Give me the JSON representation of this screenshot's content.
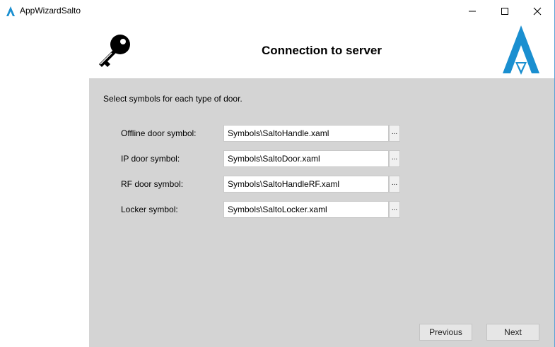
{
  "window": {
    "app_title": "AppWizardSalto",
    "brand_color": "#1a8fd0"
  },
  "header": {
    "title": "Connection to server"
  },
  "content": {
    "instructions": "Select symbols for each type of door.",
    "rows": [
      {
        "label": "Offline door symbol:",
        "value": "Symbols\\SaltoHandle.xaml",
        "browse": "..."
      },
      {
        "label": "IP door symbol:",
        "value": "Symbols\\SaltoDoor.xaml",
        "browse": "..."
      },
      {
        "label": "RF door symbol:",
        "value": "Symbols\\SaltoHandleRF.xaml",
        "browse": "..."
      },
      {
        "label": "Locker symbol:",
        "value": "Symbols\\SaltoLocker.xaml",
        "browse": "..."
      }
    ]
  },
  "footer": {
    "previous_label": "Previous",
    "next_label": "Next"
  }
}
